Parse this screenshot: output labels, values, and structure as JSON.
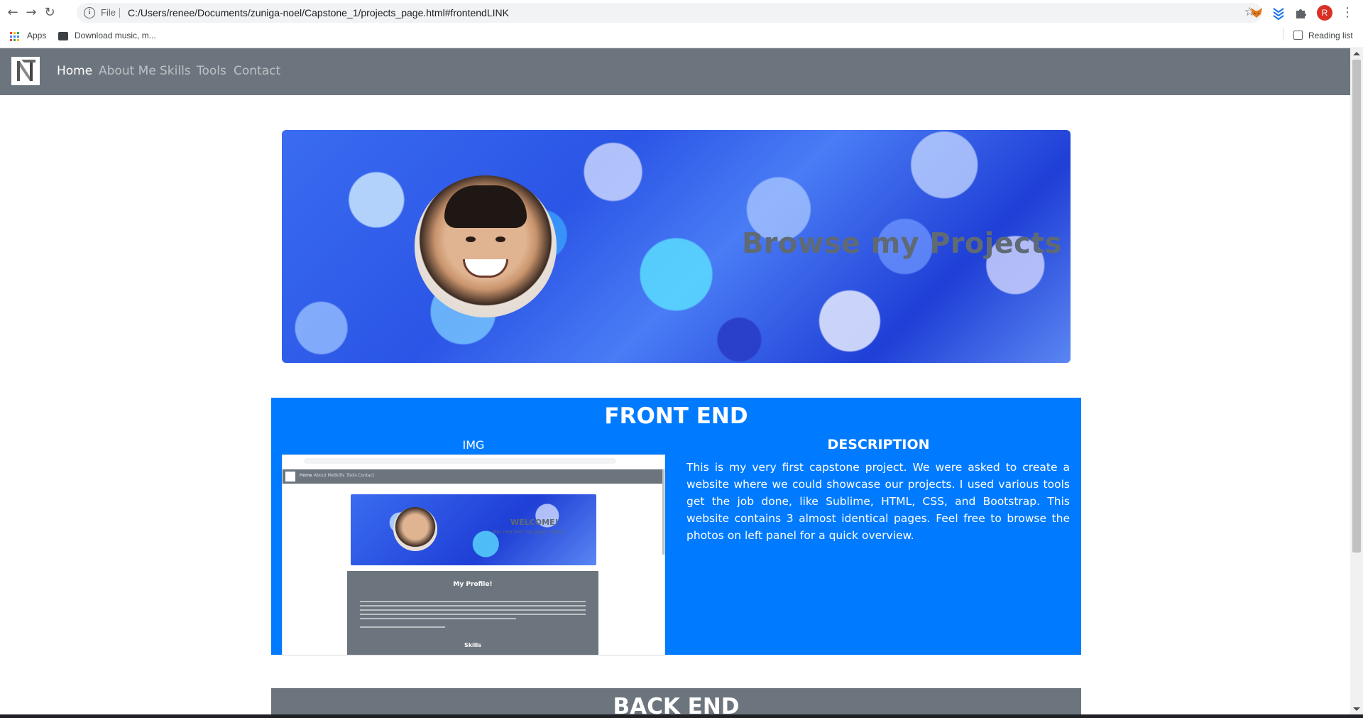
{
  "browser": {
    "omnibox": {
      "scheme_label": "File",
      "url": "C:/Users/renee/Documents/zuniga-noel/Capstone_1/projects_page.html#frontendLINK"
    },
    "bookmarks": {
      "apps_label": "Apps",
      "download_label": "Download music, m...",
      "reading_list_label": "Reading list"
    },
    "profile_initial": "R",
    "colors": {
      "profile": "#d93025"
    }
  },
  "site": {
    "nav": {
      "links": [
        "Home",
        "About Me",
        "Skills",
        "Tools",
        "Contact"
      ],
      "active": "Home"
    },
    "hero": {
      "title": "Browse my Projects"
    },
    "front_end": {
      "title": "FRONT END",
      "img_label": "IMG",
      "desc_label": "DESCRIPTION",
      "description": "This is my very first capstone project. We were asked to create a website where we could showcase our projects. I used various tools get the job done, like Sublime, HTML, CSS, and Bootstrap. This website contains 3 almost identical pages. Feel free to browse the photos on left panel for a quick overview.",
      "thumbnail": {
        "nav_links": [
          "Home",
          "About Me",
          "Skills",
          "Tools",
          "Contact"
        ],
        "welcome": "WELCOME!",
        "welcome_sub": "You reached my page, check",
        "profile_title": "My Profile!",
        "skills_title": "Skills"
      }
    },
    "back_end": {
      "title": "BACK END"
    },
    "colors": {
      "navbar": "#6c757d",
      "front_end_bg": "#007bff",
      "back_end_bg": "#6c757d"
    }
  }
}
